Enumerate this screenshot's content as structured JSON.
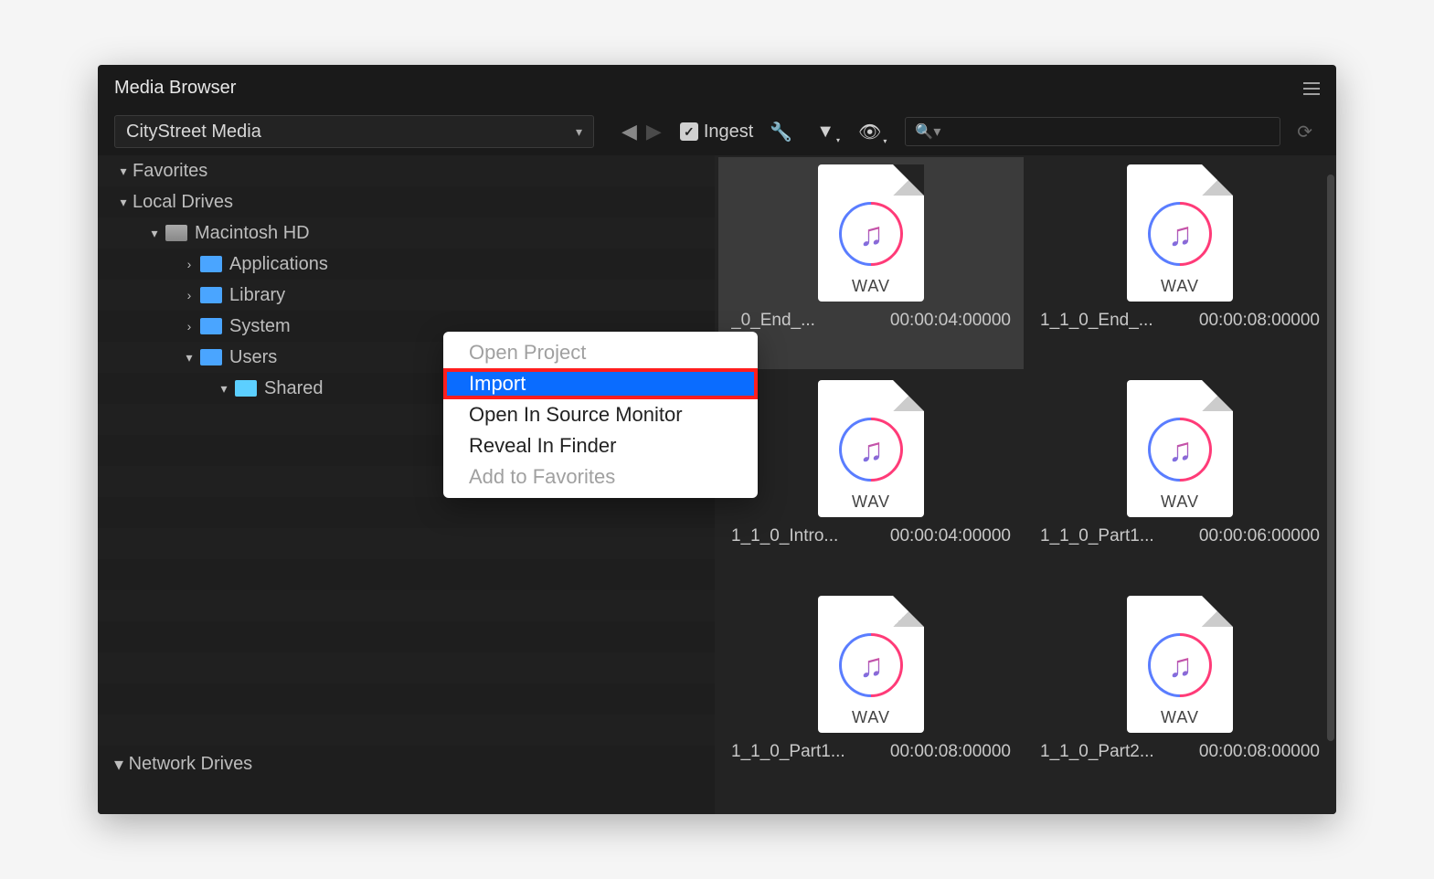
{
  "panelTitle": "Media Browser",
  "dropdown": "CityStreet Media",
  "ingestLabel": "Ingest",
  "ingestChecked": true,
  "searchPlaceholder": "",
  "tree": {
    "favorites": "Favorites",
    "localDrives": "Local Drives",
    "macintoshHD": "Macintosh HD",
    "applications": "Applications",
    "library": "Library",
    "system": "System",
    "users": "Users",
    "shared": "Shared",
    "networkDrives": "Network Drives"
  },
  "contextMenu": {
    "openProject": "Open Project",
    "import": "Import",
    "openInSourceMonitor": "Open In Source Monitor",
    "revealInFinder": "Reveal In Finder",
    "addToFavorites": "Add to Favorites"
  },
  "fileTypeLabel": "WAV",
  "files": [
    {
      "name": "_0_End_...",
      "duration": "00:00:04:00000",
      "selected": true
    },
    {
      "name": "1_1_0_End_...",
      "duration": "00:00:08:00000",
      "selected": false
    },
    {
      "name": "1_1_0_Intro...",
      "duration": "00:00:04:00000",
      "selected": false
    },
    {
      "name": "1_1_0_Part1...",
      "duration": "00:00:06:00000",
      "selected": false
    },
    {
      "name": "1_1_0_Part1...",
      "duration": "00:00:08:00000",
      "selected": false
    },
    {
      "name": "1_1_0_Part2...",
      "duration": "00:00:08:00000",
      "selected": false
    }
  ]
}
